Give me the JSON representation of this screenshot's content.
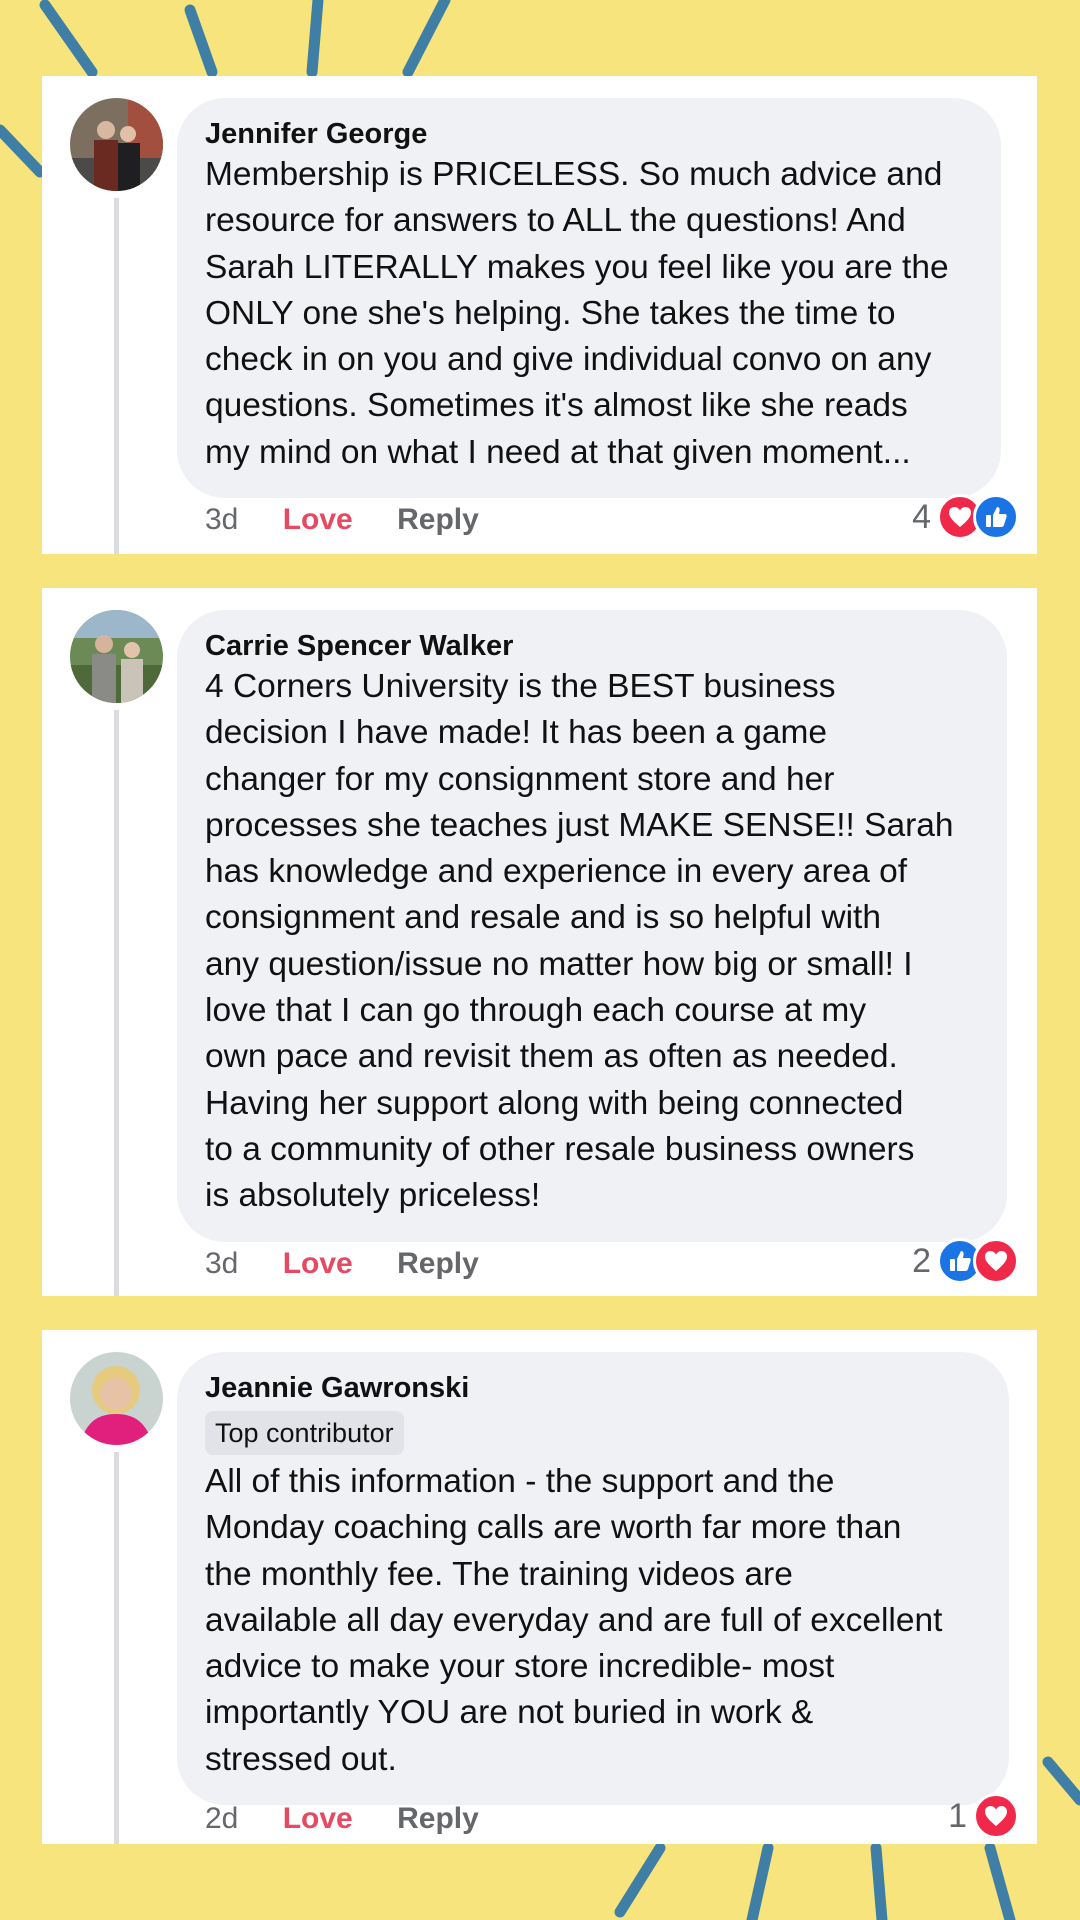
{
  "comments": [
    {
      "author": "Jennifer George",
      "badge": "",
      "text": "Membership is PRICELESS.  So much advice and\nresource for answers to ALL the questions!  And\nSarah LITERALLY makes you feel like you are the\nONLY one she's helping.  She takes the time to\ncheck in on you and give individual convo on any\nquestions.  Sometimes it's almost like she reads\nmy mind on what I need at that given moment...",
      "time": "3d",
      "love_label": "Love",
      "reply_label": "Reply",
      "reaction_count": "4",
      "reactions": [
        "heart-icon",
        "like-icon"
      ]
    },
    {
      "author": "Carrie Spencer Walker",
      "badge": "",
      "text": "4 Corners University is the BEST business\ndecision I have made! It has been a game\nchanger for my consignment store and her\nprocesses she teaches just MAKE SENSE!! Sarah\nhas knowledge and experience in every area of\nconsignment and resale and is so helpful with\nany question/issue no matter how big or small! I\nlove that I can go through each course at my\nown pace and revisit them as often as needed.\nHaving her support along with being connected\nto a community of other resale business owners\nis absolutely priceless!",
      "time": "3d",
      "love_label": "Love",
      "reply_label": "Reply",
      "reaction_count": "2",
      "reactions": [
        "like-icon",
        "heart-icon"
      ]
    },
    {
      "author": "Jeannie Gawronski",
      "badge": "Top contributor",
      "text": "All of this information - the support and the\nMonday coaching calls are worth far more than\nthe monthly fee.  The training videos are\navailable all day everyday and are full of excellent\nadvice to make your store incredible- most\nimportantly YOU are not buried in work &\nstressed out.",
      "time": "2d",
      "love_label": "Love",
      "reply_label": "Reply",
      "reaction_count": "1",
      "reactions": [
        "heart-icon"
      ]
    }
  ],
  "colors": {
    "background": "#f8e47c",
    "rays": "#3f7fa6",
    "love": "#e54a62",
    "heart": "#f0284a",
    "like": "#1b74e4"
  }
}
